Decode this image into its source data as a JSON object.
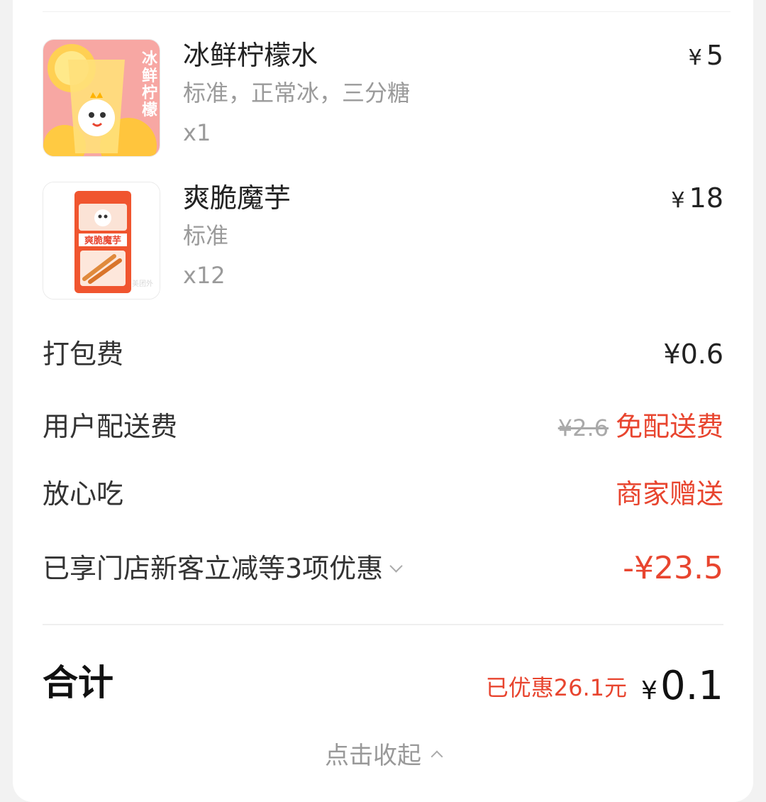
{
  "items": [
    {
      "name": "冰鲜柠檬水",
      "spec": "标准，正常冰，三分糖",
      "qty": "x1",
      "price": "5",
      "thumb_text": "冰鲜柠檬"
    },
    {
      "name": "爽脆魔芋",
      "spec": "标准",
      "qty": "x12",
      "price": "18",
      "thumb_text": "爽脆魔芋"
    }
  ],
  "currency": "¥",
  "packing_fee": {
    "label": "打包费",
    "value": "¥0.6"
  },
  "delivery_fee": {
    "label": "用户配送费",
    "original": "¥2.6",
    "value": "免配送费"
  },
  "safe_eat": {
    "label": "放心吃",
    "value": "商家赠送"
  },
  "discount": {
    "label": "已享门店新客立减等3项优惠",
    "value": "-¥23.5"
  },
  "total": {
    "label": "合计",
    "saved": "已优惠26.1元",
    "currency": "¥",
    "amount": "0.1"
  },
  "collapse_label": "点击收起",
  "colors": {
    "accent_red": "#e8452f",
    "muted": "#9a9a9a"
  }
}
